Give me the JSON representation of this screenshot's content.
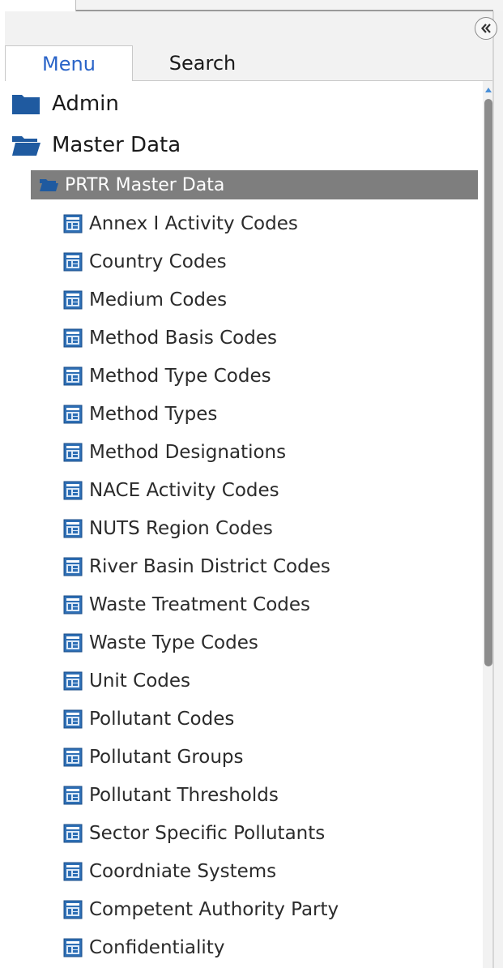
{
  "header": {
    "collapse_icon": "double-chevron-left-icon"
  },
  "tabs": [
    {
      "label": "Menu",
      "active": true
    },
    {
      "label": "Search",
      "active": false
    }
  ],
  "tree": {
    "admin": {
      "label": "Admin",
      "icon": "folder-closed-icon"
    },
    "master_data": {
      "label": "Master Data",
      "icon": "folder-open-icon"
    },
    "prtr_master_data": {
      "label": "PRTR Master Data",
      "icon": "folder-open-icon",
      "selected": true
    },
    "items": [
      {
        "label": "Annex I Activity Codes"
      },
      {
        "label": "Country Codes"
      },
      {
        "label": "Medium Codes"
      },
      {
        "label": "Method Basis Codes"
      },
      {
        "label": "Method Type Codes"
      },
      {
        "label": "Method Types"
      },
      {
        "label": "Method Designations"
      },
      {
        "label": "NACE Activity Codes"
      },
      {
        "label": "NUTS Region Codes"
      },
      {
        "label": "River Basin District Codes"
      },
      {
        "label": "Waste Treatment Codes"
      },
      {
        "label": "Waste Type Codes"
      },
      {
        "label": "Unit Codes"
      },
      {
        "label": "Pollutant Codes"
      },
      {
        "label": "Pollutant Groups"
      },
      {
        "label": "Pollutant Thresholds"
      },
      {
        "label": "Sector Specific Pollutants"
      },
      {
        "label": "Coordniate Systems"
      },
      {
        "label": "Competent Authority Party"
      },
      {
        "label": "Confidentiality"
      }
    ]
  },
  "colors": {
    "folder": "#1f5aa0",
    "active_tab_text": "#2a64c8",
    "selected_row": "#7e7e7e",
    "scroll_thumb": "#8c8c8c"
  }
}
